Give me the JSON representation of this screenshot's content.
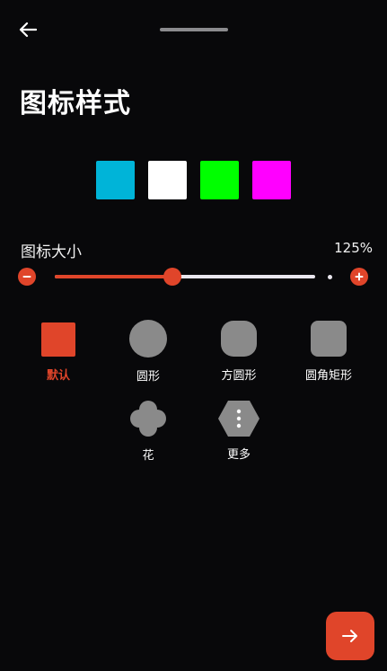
{
  "header": {
    "back_icon": "arrow-left-icon"
  },
  "title": "图标样式",
  "swatches": [
    {
      "color": "#00b4d8"
    },
    {
      "color": "#ffffff"
    },
    {
      "color": "#00ff00"
    },
    {
      "color": "#ff00ff"
    }
  ],
  "size": {
    "label": "图标大小",
    "value_text": "125%",
    "level_fraction": 0.45
  },
  "shapes": [
    {
      "label": "默认",
      "selected": true
    },
    {
      "label": "圆形"
    },
    {
      "label": "方圆形"
    },
    {
      "label": "圆角矩形"
    },
    {
      "label": "花"
    },
    {
      "label": "更多"
    }
  ],
  "colors": {
    "accent": "#e0452a",
    "background": "#08080a",
    "shape_gray": "#8a8a8a"
  },
  "footer": {
    "next_icon": "arrow-right-icon"
  }
}
